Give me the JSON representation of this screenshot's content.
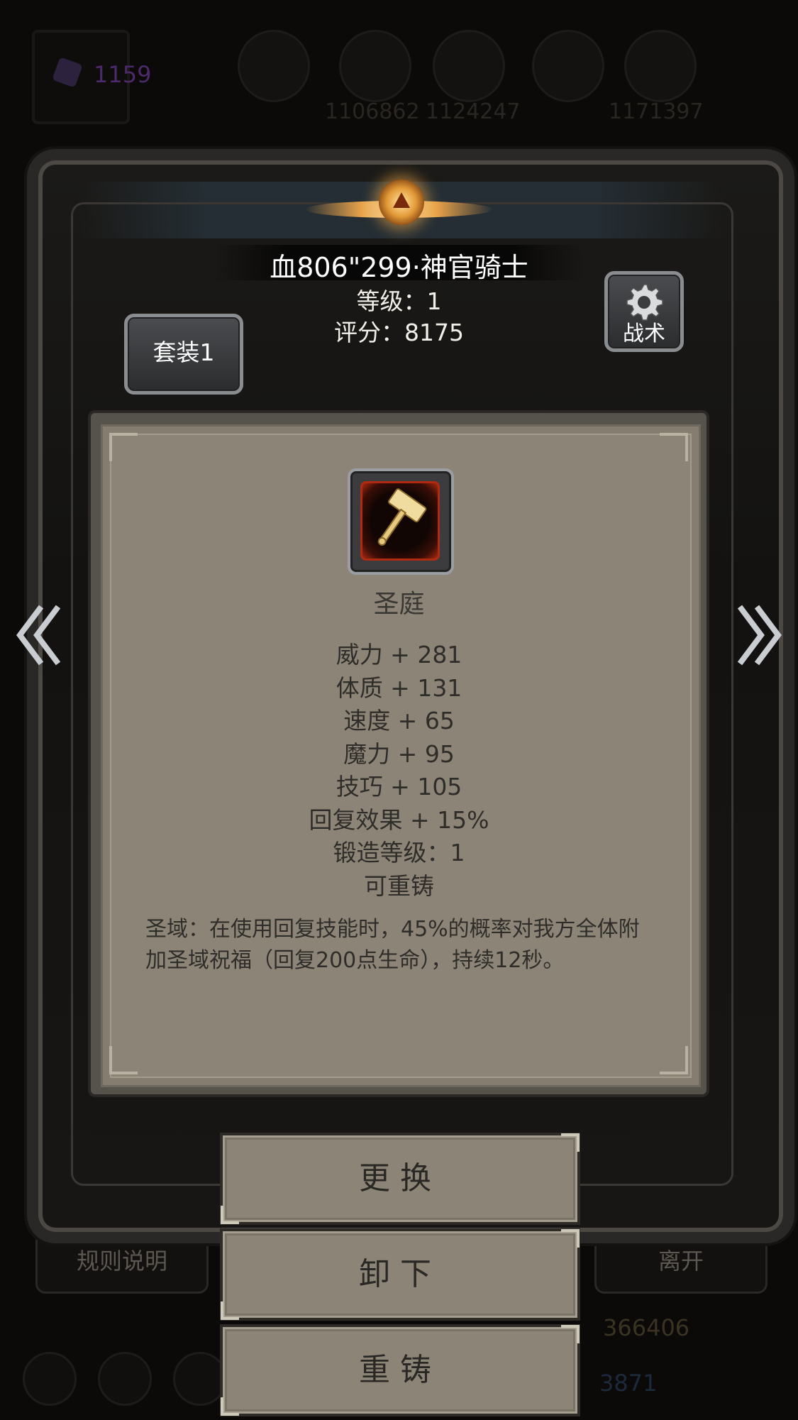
{
  "background": {
    "gem_count": "1159",
    "resources": [
      "1106862",
      "1124247",
      "1171397"
    ],
    "rules_label": "规则说明",
    "leave_label": "离开",
    "gold_count": "366406",
    "blue_count": "3871"
  },
  "character": {
    "name": "血806\"299·神官骑士",
    "level_text": "等级：1",
    "score_text": "评分：8175",
    "set_label": "套装1",
    "tactics_label": "战术"
  },
  "item": {
    "name": "圣庭",
    "stats": [
      "威力 + 281",
      "体质 + 131",
      "速度 + 65",
      "魔力 + 95",
      "技巧 + 105",
      "回复效果 + 15%",
      "锻造等级：1",
      "可重铸"
    ],
    "description": "圣域：在使用回复技能时，45%的概率对我方全体附加圣域祝福（回复200点生命），持续12秒。"
  },
  "actions": {
    "replace_label": "更换",
    "unequip_label": "卸下",
    "reforge_label": "重铸"
  },
  "colors": {
    "panel": "#8c8577",
    "frame": "#2a2826",
    "crest_gold": "#e8a34a"
  },
  "icons": [
    "gem-icon",
    "gear-icon",
    "hammer-icon",
    "left-arrow-icon",
    "right-arrow-icon"
  ]
}
